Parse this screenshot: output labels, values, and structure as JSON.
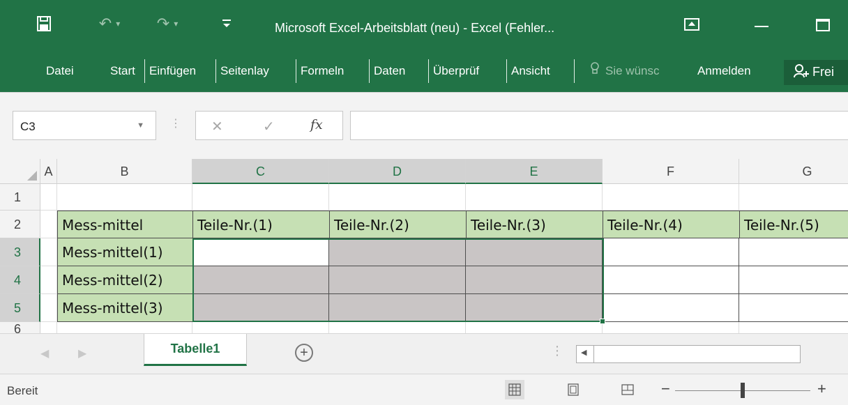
{
  "app": {
    "window_title": "Microsoft Excel-Arbeitsblatt (neu) - Excel (Fehler..."
  },
  "menu": {
    "file": "Datei",
    "tabs": [
      "Start",
      "Einfügen",
      "Seitenlay",
      "Formeln",
      "Daten",
      "Überprüf",
      "Ansicht"
    ],
    "tell_me": "Sie wünsc",
    "sign_in": "Anmelden",
    "share": "Frei"
  },
  "formula_bar": {
    "name_box": "C3",
    "formula_value": ""
  },
  "grid": {
    "columns": [
      "A",
      "B",
      "C",
      "D",
      "E",
      "F",
      "G"
    ],
    "selected_columns": [
      "C",
      "D",
      "E"
    ],
    "rows": [
      "1",
      "2",
      "3",
      "4",
      "5",
      "6"
    ],
    "selected_rows": [
      "3",
      "4",
      "5"
    ],
    "cells": {
      "B2": "Mess-mittel",
      "C2": "Teile-Nr.(1)",
      "D2": "Teile-Nr.(2)",
      "E2": "Teile-Nr.(3)",
      "F2": "Teile-Nr.(4)",
      "G2": "Teile-Nr.(5)",
      "B3": "Mess-mittel(1)",
      "B4": "Mess-mittel(2)",
      "B5": "Mess-mittel(3)"
    }
  },
  "sheets": {
    "active": "Tabelle1"
  },
  "status": {
    "text": "Bereit",
    "zoom_level_fraction": 0.5
  },
  "colors": {
    "excel_green": "#217346",
    "header_fill": "#c6e0b4",
    "shaded_fill": "#c9c5c5"
  },
  "icons": [
    "save-icon",
    "undo-icon",
    "redo-icon",
    "customize-qat-icon",
    "ribbon-display-icon",
    "minimize-icon",
    "maximize-icon",
    "lightbulb-icon",
    "share-person-icon",
    "dropdown-arrow-icon",
    "cancel-icon",
    "enter-icon",
    "fx-icon",
    "add-sheet-icon",
    "normal-view-icon",
    "page-layout-icon",
    "page-break-icon"
  ]
}
